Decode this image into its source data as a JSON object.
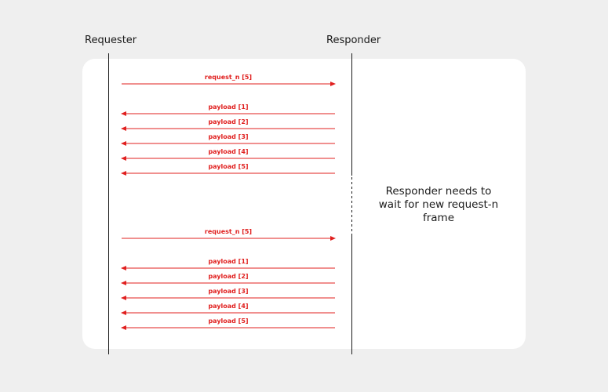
{
  "lanes": {
    "requester": "Requester",
    "responder": "Responder"
  },
  "note": "Responder needs to wait for new request-n frame",
  "colors": {
    "arrow": "#e0201f",
    "lifeline": "#1a1a1a",
    "panel": "#ffffff",
    "background": "#efefef"
  },
  "groups": [
    {
      "request": {
        "label": "request_n [5]",
        "direction": "requester-to-responder"
      },
      "payloads": [
        {
          "label": "payload [1]",
          "direction": "responder-to-requester"
        },
        {
          "label": "payload [2]",
          "direction": "responder-to-requester"
        },
        {
          "label": "payload [3]",
          "direction": "responder-to-requester"
        },
        {
          "label": "payload [4]",
          "direction": "responder-to-requester"
        },
        {
          "label": "payload [5]",
          "direction": "responder-to-requester"
        }
      ]
    },
    {
      "request": {
        "label": "request_n [5]",
        "direction": "requester-to-responder"
      },
      "payloads": [
        {
          "label": "payload [1]",
          "direction": "responder-to-requester"
        },
        {
          "label": "payload [2]",
          "direction": "responder-to-requester"
        },
        {
          "label": "payload [3]",
          "direction": "responder-to-requester"
        },
        {
          "label": "payload [4]",
          "direction": "responder-to-requester"
        },
        {
          "label": "payload [5]",
          "direction": "responder-to-requester"
        }
      ]
    }
  ]
}
